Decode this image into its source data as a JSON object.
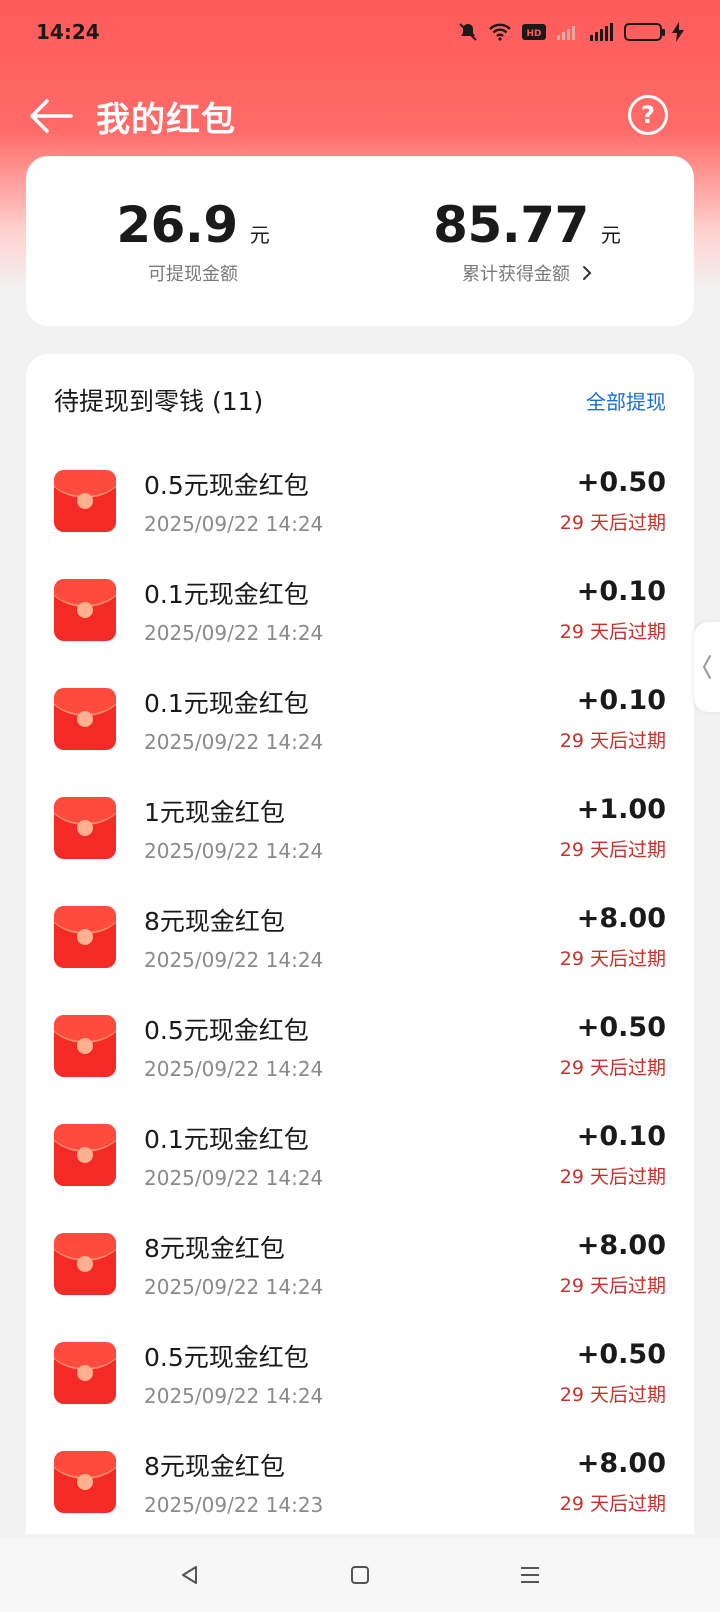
{
  "status": {
    "time": "14:24"
  },
  "header": {
    "title": "我的红包",
    "help_symbol": "?"
  },
  "summary": {
    "available": {
      "amount": "26.9",
      "unit": "元",
      "label": "可提现金额"
    },
    "total": {
      "amount": "85.77",
      "unit": "元",
      "label": "累计获得金额"
    }
  },
  "list": {
    "title": "待提现到零钱 (11)",
    "action": "全部提现",
    "items": [
      {
        "name": "0.5元现金红包",
        "time": "2025/09/22 14:24",
        "amount": "+0.50",
        "expiry": "29 天后过期"
      },
      {
        "name": "0.1元现金红包",
        "time": "2025/09/22 14:24",
        "amount": "+0.10",
        "expiry": "29 天后过期"
      },
      {
        "name": "0.1元现金红包",
        "time": "2025/09/22 14:24",
        "amount": "+0.10",
        "expiry": "29 天后过期"
      },
      {
        "name": "1元现金红包",
        "time": "2025/09/22 14:24",
        "amount": "+1.00",
        "expiry": "29 天后过期"
      },
      {
        "name": "8元现金红包",
        "time": "2025/09/22 14:24",
        "amount": "+8.00",
        "expiry": "29 天后过期"
      },
      {
        "name": "0.5元现金红包",
        "time": "2025/09/22 14:24",
        "amount": "+0.50",
        "expiry": "29 天后过期"
      },
      {
        "name": "0.1元现金红包",
        "time": "2025/09/22 14:24",
        "amount": "+0.10",
        "expiry": "29 天后过期"
      },
      {
        "name": "8元现金红包",
        "time": "2025/09/22 14:24",
        "amount": "+8.00",
        "expiry": "29 天后过期"
      },
      {
        "name": "0.5元现金红包",
        "time": "2025/09/22 14:24",
        "amount": "+0.50",
        "expiry": "29 天后过期"
      },
      {
        "name": "8元现金红包",
        "time": "2025/09/22 14:23",
        "amount": "+8.00",
        "expiry": "29 天后过期"
      }
    ]
  },
  "colors": {
    "brand_red": "#ff5a5a",
    "envelope_red": "#f32a25",
    "expiry_red": "#c9302c",
    "link_blue": "#1a6fd6"
  },
  "icons": {
    "back": "back-arrow-icon",
    "help": "help-icon",
    "chevron": "chevron-right-icon",
    "envelope": "red-envelope-icon",
    "side_handle": "chevron-left-icon"
  }
}
